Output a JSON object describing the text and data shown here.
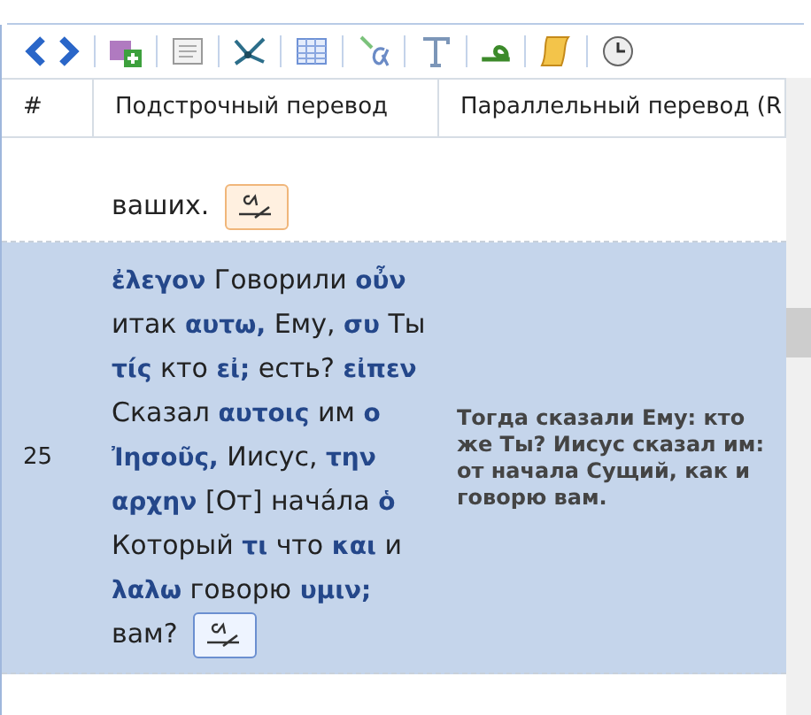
{
  "table": {
    "columns": [
      "#",
      "Подстрочный перевод",
      "Параллельный перевод (R"
    ],
    "rows": [
      {
        "number": "",
        "selected": false,
        "tokens": [
          {
            "kind": "russian",
            "text": "ваших."
          }
        ],
        "parallel": ""
      },
      {
        "number": "25",
        "selected": true,
        "tokens": [
          {
            "kind": "greek",
            "text": "ἐλεγον"
          },
          {
            "kind": "russian",
            "text": "Говорили"
          },
          {
            "kind": "greek",
            "text": "οὖν"
          },
          {
            "kind": "russian",
            "text": "итак"
          },
          {
            "kind": "greek",
            "text": "αυτω,"
          },
          {
            "kind": "russian",
            "text": "Ему,"
          },
          {
            "kind": "greek",
            "text": "συ"
          },
          {
            "kind": "russian",
            "text": "Ты"
          },
          {
            "kind": "greek",
            "text": "τίς"
          },
          {
            "kind": "russian",
            "text": "кто"
          },
          {
            "kind": "greek",
            "text": "εἰ;"
          },
          {
            "kind": "russian",
            "text": "есть?"
          },
          {
            "kind": "greek",
            "text": "εἰπεν"
          },
          {
            "kind": "russian",
            "text": "Сказал"
          },
          {
            "kind": "greek",
            "text": "αυτοις"
          },
          {
            "kind": "russian",
            "text": "им"
          },
          {
            "kind": "greek",
            "text": "ο Ἰησοῦς,"
          },
          {
            "kind": "russian",
            "text": "Иисус,"
          },
          {
            "kind": "greek",
            "text": "την αρχην"
          },
          {
            "kind": "russian",
            "text": "[От] начáла"
          },
          {
            "kind": "greek",
            "text": "ὁ"
          },
          {
            "kind": "russian",
            "text": "Который"
          },
          {
            "kind": "greek",
            "text": "τι"
          },
          {
            "kind": "russian",
            "text": "что"
          },
          {
            "kind": "greek",
            "text": "και"
          },
          {
            "kind": "russian",
            "text": "и"
          },
          {
            "kind": "greek",
            "text": "λαλω"
          },
          {
            "kind": "russian",
            "text": "говорю"
          },
          {
            "kind": "greek",
            "text": "υμιν;"
          },
          {
            "kind": "russian",
            "text": "вам?"
          }
        ],
        "parallel": "Тогда сказали Ему: кто же Ты? Иисус сказал им: от начала Сущий, как и говорю вам."
      }
    ]
  }
}
